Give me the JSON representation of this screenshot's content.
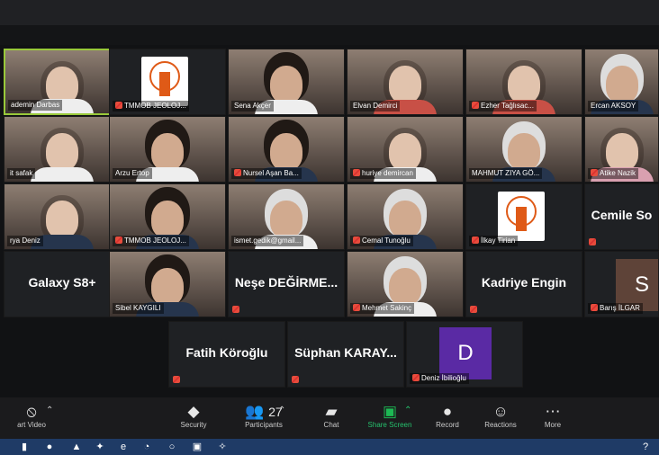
{
  "tiles": [
    {
      "name": "ademin Darbas",
      "type": "video",
      "muted": false,
      "class": "light",
      "shirt": "white"
    },
    {
      "name": "TMMOB JEOLOJ...",
      "type": "logo",
      "muted": true
    },
    {
      "name": "Sena Akçer",
      "type": "video",
      "muted": false,
      "class": "hair-dark",
      "shirt": "white"
    },
    {
      "name": "Elvan Demirci",
      "type": "video",
      "muted": false,
      "class": "light",
      "shirt": "red"
    },
    {
      "name": "Ezher Tağlısac...",
      "type": "video",
      "muted": true,
      "class": "light",
      "shirt": "red"
    },
    {
      "name": "Ercan AKSOY",
      "type": "video",
      "muted": false,
      "class": "hair-grey",
      "shirt": "blue"
    },
    {
      "name": "it safak",
      "type": "video",
      "muted": false,
      "class": "light",
      "shirt": "white"
    },
    {
      "name": "Arzu Ertop",
      "type": "video",
      "muted": false,
      "class": "hair-dark",
      "shirt": "white"
    },
    {
      "name": "Nursel Aşan Ba...",
      "type": "video",
      "muted": true,
      "class": "hair-dark",
      "shirt": "blue"
    },
    {
      "name": "huriye demircan",
      "type": "video",
      "muted": true,
      "class": "light",
      "shirt": "white"
    },
    {
      "name": "MAHMUT ZIYA GÖ...",
      "type": "video",
      "muted": false,
      "class": "hair-grey",
      "shirt": "blue"
    },
    {
      "name": "Atike Nazik",
      "type": "video",
      "muted": true,
      "class": "light",
      "shirt": "pink"
    },
    {
      "name": "rya Deniz",
      "type": "video",
      "muted": false,
      "class": "light",
      "shirt": "blue"
    },
    {
      "name": "TMMOB JEOLOJ...",
      "type": "video",
      "muted": true,
      "class": "hair-dark",
      "shirt": "blue"
    },
    {
      "name": "ismet.gedik@gmail...",
      "type": "video",
      "muted": false,
      "class": "hair-grey",
      "shirt": "white"
    },
    {
      "name": "Cemal Tunoğlu",
      "type": "video",
      "muted": true,
      "class": "hair-grey",
      "shirt": "blue"
    },
    {
      "name": "İlkay Tirian",
      "type": "logo",
      "muted": true
    },
    {
      "name": "Cemile So",
      "type": "text",
      "muted": true
    },
    {
      "name": "Galaxy S8+",
      "type": "text",
      "muted": false
    },
    {
      "name": "Sibel KAYGILI",
      "type": "video",
      "muted": false,
      "class": "hair-dark",
      "shirt": "blue"
    },
    {
      "name": "Neşe DEĞİRME...",
      "type": "text",
      "muted": true
    },
    {
      "name": "Mehmet Sakinç",
      "type": "video",
      "muted": true,
      "class": "hair-grey",
      "shirt": "white"
    },
    {
      "name": "Kadriye Engin",
      "type": "text",
      "muted": true
    },
    {
      "name": "Barış İLGAR",
      "type": "avatar",
      "muted": true,
      "letter": "S",
      "avatarColor": "#5e4338"
    },
    {
      "name": "Fatih Köroğlu",
      "type": "text",
      "muted": true
    },
    {
      "name": "Süphan KARAY...",
      "type": "text",
      "muted": true
    },
    {
      "name": "Deniz İbilioğlu",
      "type": "avatar",
      "muted": true,
      "letter": "D",
      "avatarColor": "#5a2aa4"
    }
  ],
  "toolbar": {
    "start_video": "art Video",
    "security": "Security",
    "participants": "Participants",
    "participants_count": "27",
    "chat": "Chat",
    "share_screen": "Share Screen",
    "record": "Record",
    "reactions": "Reactions",
    "more": "More"
  }
}
